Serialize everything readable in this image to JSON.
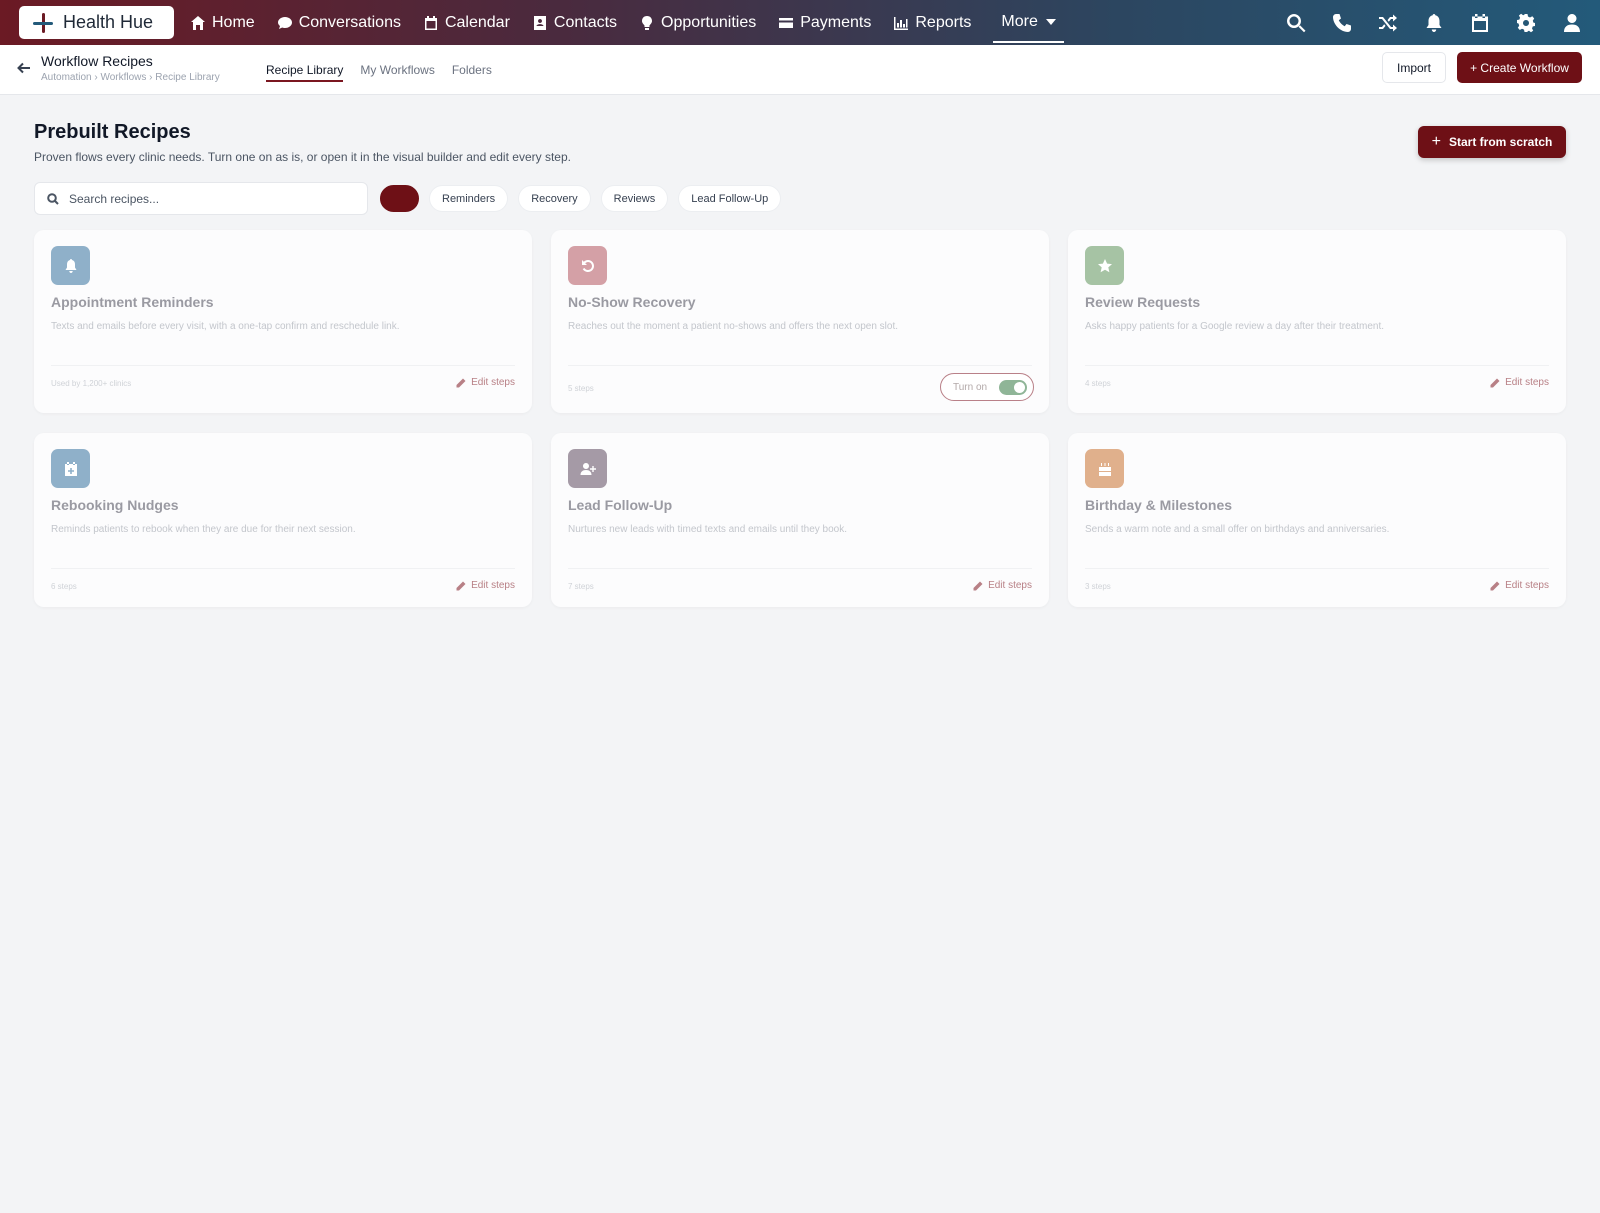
{
  "brand": {
    "name": "Health Hue"
  },
  "nav": {
    "items": [
      {
        "label": "Home",
        "icon": "home-icon"
      },
      {
        "label": "Conversations",
        "icon": "chat-bubble-icon"
      },
      {
        "label": "Calendar",
        "icon": "calendar-icon"
      },
      {
        "label": "Contacts",
        "icon": "contact-card-icon"
      },
      {
        "label": "Opportunities",
        "icon": "lightbulb-icon"
      },
      {
        "label": "Payments",
        "icon": "credit-card-icon"
      },
      {
        "label": "Reports",
        "icon": "bar-chart-icon"
      }
    ],
    "more_label": "More",
    "right_icons": [
      "search-icon",
      "phone-icon",
      "shuffle-icon",
      "bell-icon",
      "calendar-icon",
      "gear-icon",
      "user-icon"
    ]
  },
  "subheader": {
    "title": "Workflow Recipes",
    "breadcrumb": "Automation › Workflows › Recipe Library",
    "tabs": [
      {
        "label": "Recipe Library",
        "active": true
      },
      {
        "label": "My Workflows",
        "active": false
      },
      {
        "label": "Folders",
        "active": false
      }
    ],
    "import_label": "Import",
    "create_label": "+ Create Workflow"
  },
  "page": {
    "title": "Prebuilt Recipes",
    "subtitle": "Proven flows every clinic needs. Turn one on as is, or open it in the visual builder and edit every step.",
    "scratch_label": "Start from scratch",
    "search_placeholder": "Search recipes...",
    "filters": [
      {
        "label": "",
        "active": true
      },
      {
        "label": "Reminders",
        "active": false
      },
      {
        "label": "Recovery",
        "active": false
      },
      {
        "label": "Reviews",
        "active": false
      },
      {
        "label": "Lead Follow-Up",
        "active": false
      }
    ]
  },
  "recipes": [
    {
      "title": "Appointment Reminders",
      "desc": "Texts and emails before every visit, with a one-tap confirm and reschedule link.",
      "meta": "Used by 1,200+ clinics",
      "action": "Edit steps",
      "icon": "bell-icon",
      "color": "#8fb0c9"
    },
    {
      "title": "No-Show Recovery",
      "desc": "Reaches out the moment a patient no-shows and offers the next open slot.",
      "meta": "5 steps",
      "action": "Turn on",
      "icon": "undo-icon",
      "color": "#d4a0a6",
      "toggle": true
    },
    {
      "title": "Review Requests",
      "desc": "Asks happy patients for a Google review a day after their treatment.",
      "meta": "4 steps",
      "action": "Edit steps",
      "icon": "star-icon",
      "color": "#a6c3a4"
    },
    {
      "title": "Rebooking Nudges",
      "desc": "Reminds patients to rebook when they are due for their next session.",
      "meta": "6 steps",
      "action": "Edit steps",
      "icon": "calendar-plus-icon",
      "color": "#8fb0c9"
    },
    {
      "title": "Lead Follow-Up",
      "desc": "Nurtures new leads with timed texts and emails until they book.",
      "meta": "7 steps",
      "action": "Edit steps",
      "icon": "user-plus-icon",
      "color": "#a59aa6"
    },
    {
      "title": "Birthday & Milestones",
      "desc": "Sends a warm note and a small offer on birthdays and anniversaries.",
      "meta": "3 steps",
      "action": "Edit steps",
      "icon": "cake-icon",
      "color": "#e0b08c"
    }
  ],
  "colors": {
    "accent": "#6e1016",
    "nav_start": "#6b1a24",
    "nav_end": "#235a7a",
    "toggle_on": "#8fb597"
  }
}
